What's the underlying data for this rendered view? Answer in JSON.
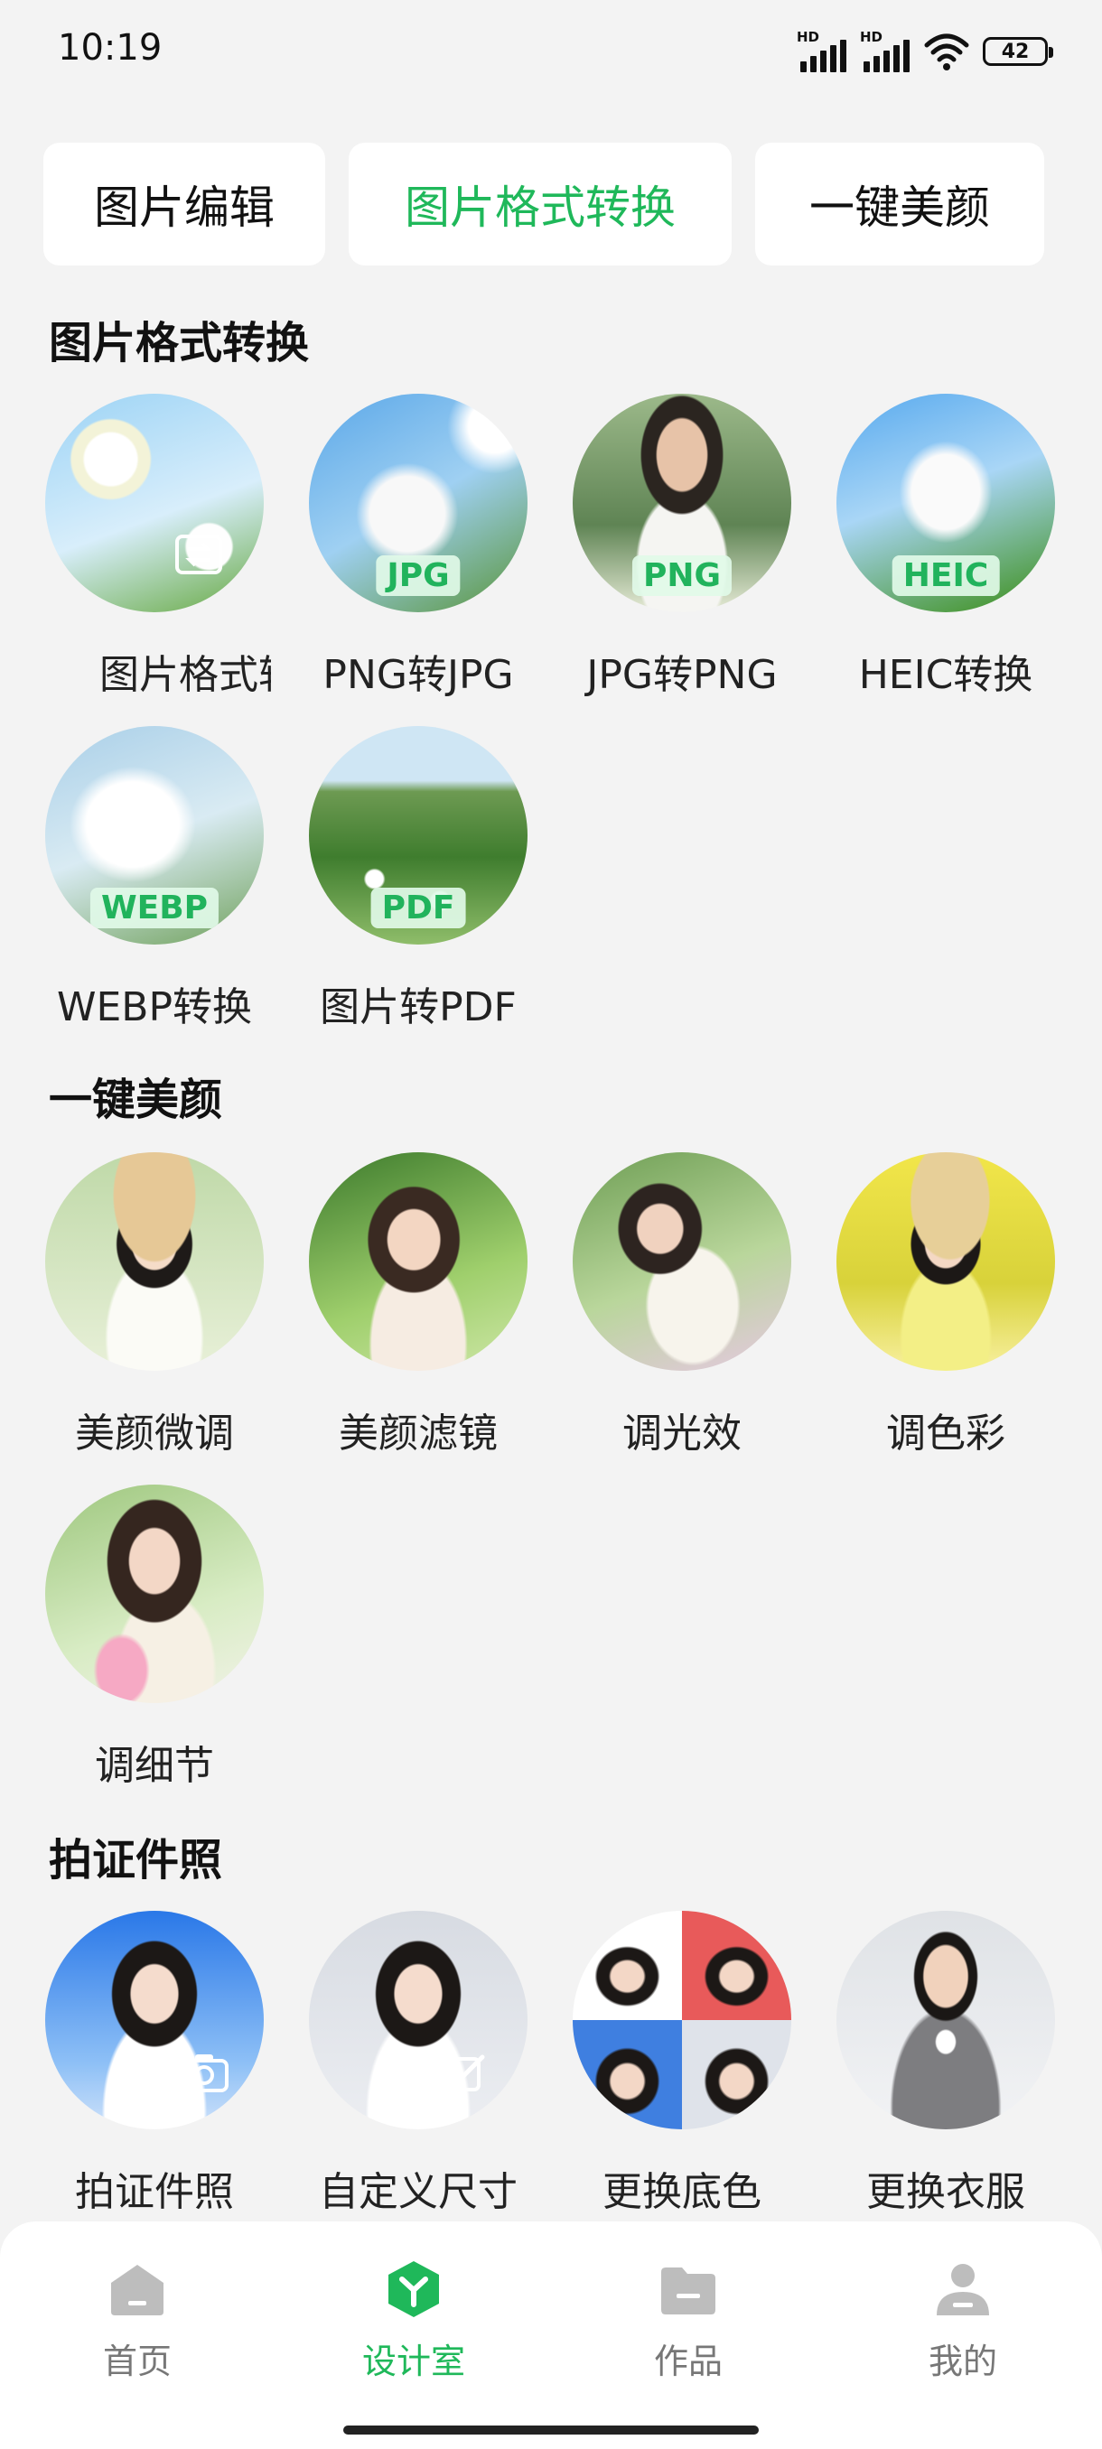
{
  "status_bar": {
    "time": "10:19",
    "battery": "42",
    "hd_label": "HD"
  },
  "tabs": [
    {
      "label": "图片编辑",
      "active": false
    },
    {
      "label": "图片格式转换",
      "active": true
    },
    {
      "label": "一键美颜",
      "active": false
    }
  ],
  "sections": {
    "format": {
      "title": "图片格式转换",
      "items": [
        {
          "label": "图片格式转换",
          "badge": "",
          "icon": "convert-icon"
        },
        {
          "label": "PNG转JPG",
          "badge": "JPG"
        },
        {
          "label": "JPG转PNG",
          "badge": "PNG"
        },
        {
          "label": "HEIC转换",
          "badge": "HEIC"
        },
        {
          "label": "WEBP转换",
          "badge": "WEBP"
        },
        {
          "label": "图片转PDF",
          "badge": "PDF"
        }
      ]
    },
    "beauty": {
      "title": "一键美颜",
      "items": [
        {
          "label": "美颜微调"
        },
        {
          "label": "美颜滤镜"
        },
        {
          "label": "调光效"
        },
        {
          "label": "调色彩"
        },
        {
          "label": "调细节"
        }
      ]
    },
    "id_photo": {
      "title": "拍证件照",
      "items": [
        {
          "label": "拍证件照",
          "icon": "camera-icon"
        },
        {
          "label": "自定义尺寸",
          "icon": "edit-icon"
        },
        {
          "label": "更换底色"
        },
        {
          "label": "更换衣服"
        }
      ]
    }
  },
  "bottom_nav": [
    {
      "label": "首页",
      "icon": "home-icon",
      "active": false
    },
    {
      "label": "设计室",
      "icon": "design-icon",
      "active": true
    },
    {
      "label": "作品",
      "icon": "folder-icon",
      "active": false
    },
    {
      "label": "我的",
      "icon": "user-icon",
      "active": false
    }
  ],
  "colors": {
    "accent": "#1fb85a",
    "background": "#f3f3f3"
  }
}
